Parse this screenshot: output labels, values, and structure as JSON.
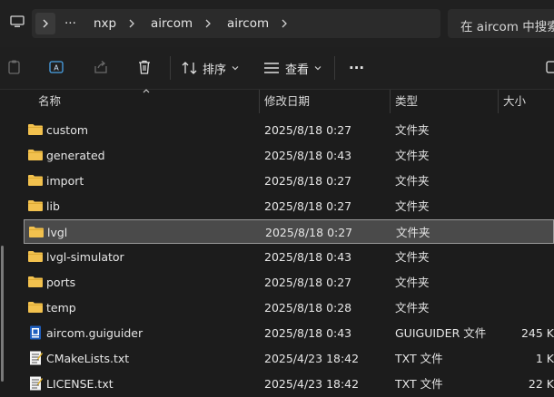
{
  "address": {
    "breadcrumbs": [
      "nxp",
      "aircom",
      "aircom"
    ],
    "more": "···",
    "search_placeholder": "在 aircom 中搜索"
  },
  "toolbar": {
    "sort_label": "排序",
    "view_label": "查看",
    "more_label": "···"
  },
  "columns": {
    "name": "名称",
    "modified": "修改日期",
    "type": "类型",
    "size": "大小"
  },
  "files": [
    {
      "name": "custom",
      "modified": "2025/8/18 0:27",
      "type": "文件夹",
      "size": "",
      "icon": "folder-icon"
    },
    {
      "name": "generated",
      "modified": "2025/8/18 0:43",
      "type": "文件夹",
      "size": "",
      "icon": "folder-icon"
    },
    {
      "name": "import",
      "modified": "2025/8/18 0:27",
      "type": "文件夹",
      "size": "",
      "icon": "folder-icon"
    },
    {
      "name": "lib",
      "modified": "2025/8/18 0:27",
      "type": "文件夹",
      "size": "",
      "icon": "folder-icon"
    },
    {
      "name": "lvgl",
      "modified": "2025/8/18 0:27",
      "type": "文件夹",
      "size": "",
      "icon": "folder-icon",
      "selected": true
    },
    {
      "name": "lvgl-simulator",
      "modified": "2025/8/18 0:43",
      "type": "文件夹",
      "size": "",
      "icon": "folder-icon"
    },
    {
      "name": "ports",
      "modified": "2025/8/18 0:27",
      "type": "文件夹",
      "size": "",
      "icon": "folder-icon"
    },
    {
      "name": "temp",
      "modified": "2025/8/18 0:28",
      "type": "文件夹",
      "size": "",
      "icon": "folder-icon"
    },
    {
      "name": "aircom.guiguider",
      "modified": "2025/8/18 0:43",
      "type": "GUIGUIDER 文件",
      "size": "245 K",
      "icon": "guiguider-file-icon"
    },
    {
      "name": "CMakeLists.txt",
      "modified": "2025/4/23 18:42",
      "type": "TXT 文件",
      "size": "1 K",
      "icon": "text-file-icon"
    },
    {
      "name": "LICENSE.txt",
      "modified": "2025/4/23 18:42",
      "type": "TXT 文件",
      "size": "22 K",
      "icon": "text-file-icon"
    }
  ],
  "colors": {
    "folder": "#f2c14e",
    "background": "#1c1c1c",
    "selected_row": "#4a4a4a"
  }
}
